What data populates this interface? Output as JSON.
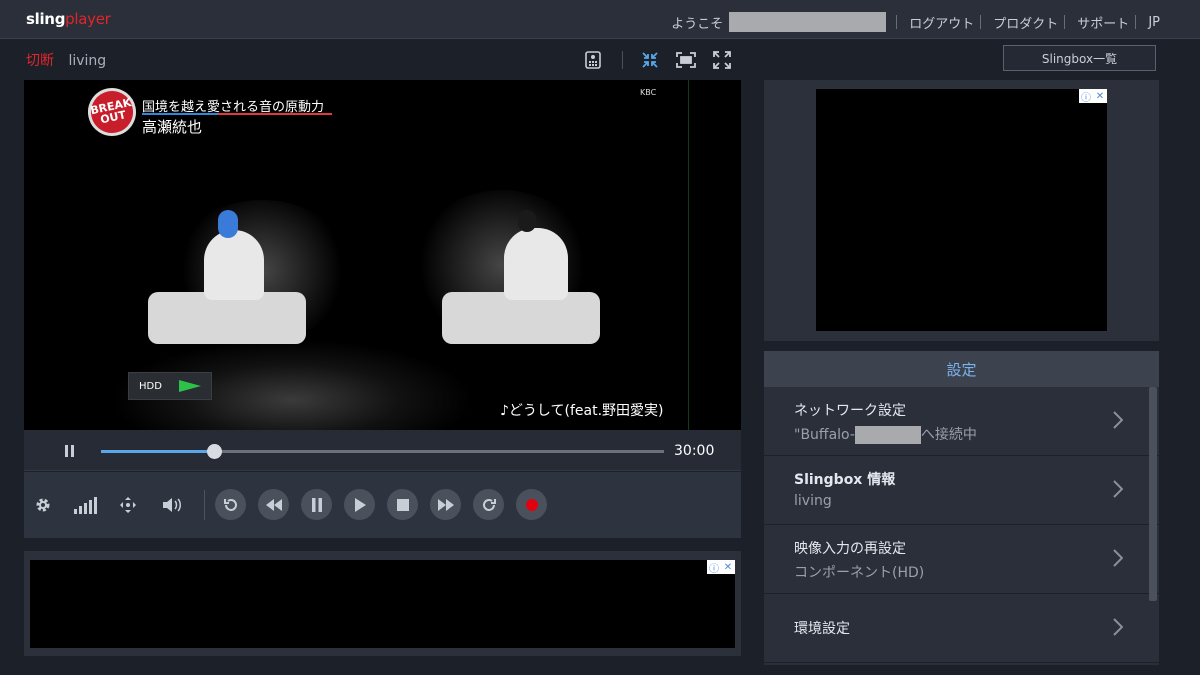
{
  "app": {
    "logo_part1": "sling",
    "logo_part2": "player"
  },
  "topnav": {
    "welcome": "ようこそ",
    "logout": "ログアウト",
    "product": "プロダクト",
    "support": "サポート",
    "lang": "JP"
  },
  "status": {
    "disconnect": "切断",
    "box_name": "living"
  },
  "slingbox_list_button": "Slingbox一覧",
  "video": {
    "badge": "BREAK OUT",
    "overlay_title": "国境を越え愛される音の原動力",
    "overlay_artist": "高瀬統也",
    "channel": "KBC",
    "hdd_label": "HDD",
    "song": "♪どうして(feat.野田愛実)"
  },
  "seek": {
    "progress": 0.2,
    "duration": "30:00"
  },
  "settings": {
    "header": "設定",
    "items": [
      {
        "title": "ネットワーク設定",
        "subtitle_pre": "\"Buffalo-",
        "subtitle_post": "へ接続中"
      },
      {
        "title": "Slingbox 情報",
        "subtitle": "living"
      },
      {
        "title": "映像入力の再設定",
        "subtitle": "コンポーネント(HD)"
      },
      {
        "title": "環境設定"
      }
    ]
  },
  "ad": {
    "info_icon": "ⓘ",
    "close_icon": "✕"
  },
  "colors": {
    "accent": "#5aa6e6",
    "brand_red": "#e0262b",
    "record_red": "#e3000f",
    "header_blue": "#7bb4ef"
  },
  "icons": [
    "remote-icon",
    "shrink-icon",
    "fit-icon",
    "fullscreen-icon",
    "settings-gear-icon",
    "signal-icon",
    "move-icon",
    "volume-icon",
    "replay-icon",
    "rewind-icon",
    "pause-icon",
    "play-icon",
    "stop-icon",
    "fast-forward-icon",
    "skip-forward-icon",
    "record-icon",
    "chevron-right-icon"
  ]
}
